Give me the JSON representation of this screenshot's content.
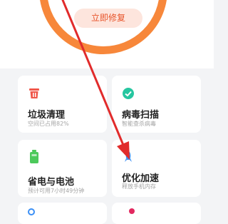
{
  "hero": {
    "repair_button": "立即修复"
  },
  "cards": [
    {
      "title": "垃圾清理",
      "subtitle": "空间已占用82%",
      "icon": "trash-icon",
      "color": "#f0574a"
    },
    {
      "title": "病毒扫描",
      "subtitle": "智能查杀病毒",
      "icon": "shield-check-icon",
      "color": "#26c6a0"
    },
    {
      "title": "省电与电池",
      "subtitle": "预计可用7小时49分钟",
      "icon": "battery-icon",
      "color": "#4cc95b"
    },
    {
      "title": "优化加速",
      "subtitle": "释放手机内存",
      "icon": "rocket-icon",
      "color": "#3b8ff5"
    }
  ],
  "annotation_arrow": {
    "color": "#e12b2b"
  }
}
